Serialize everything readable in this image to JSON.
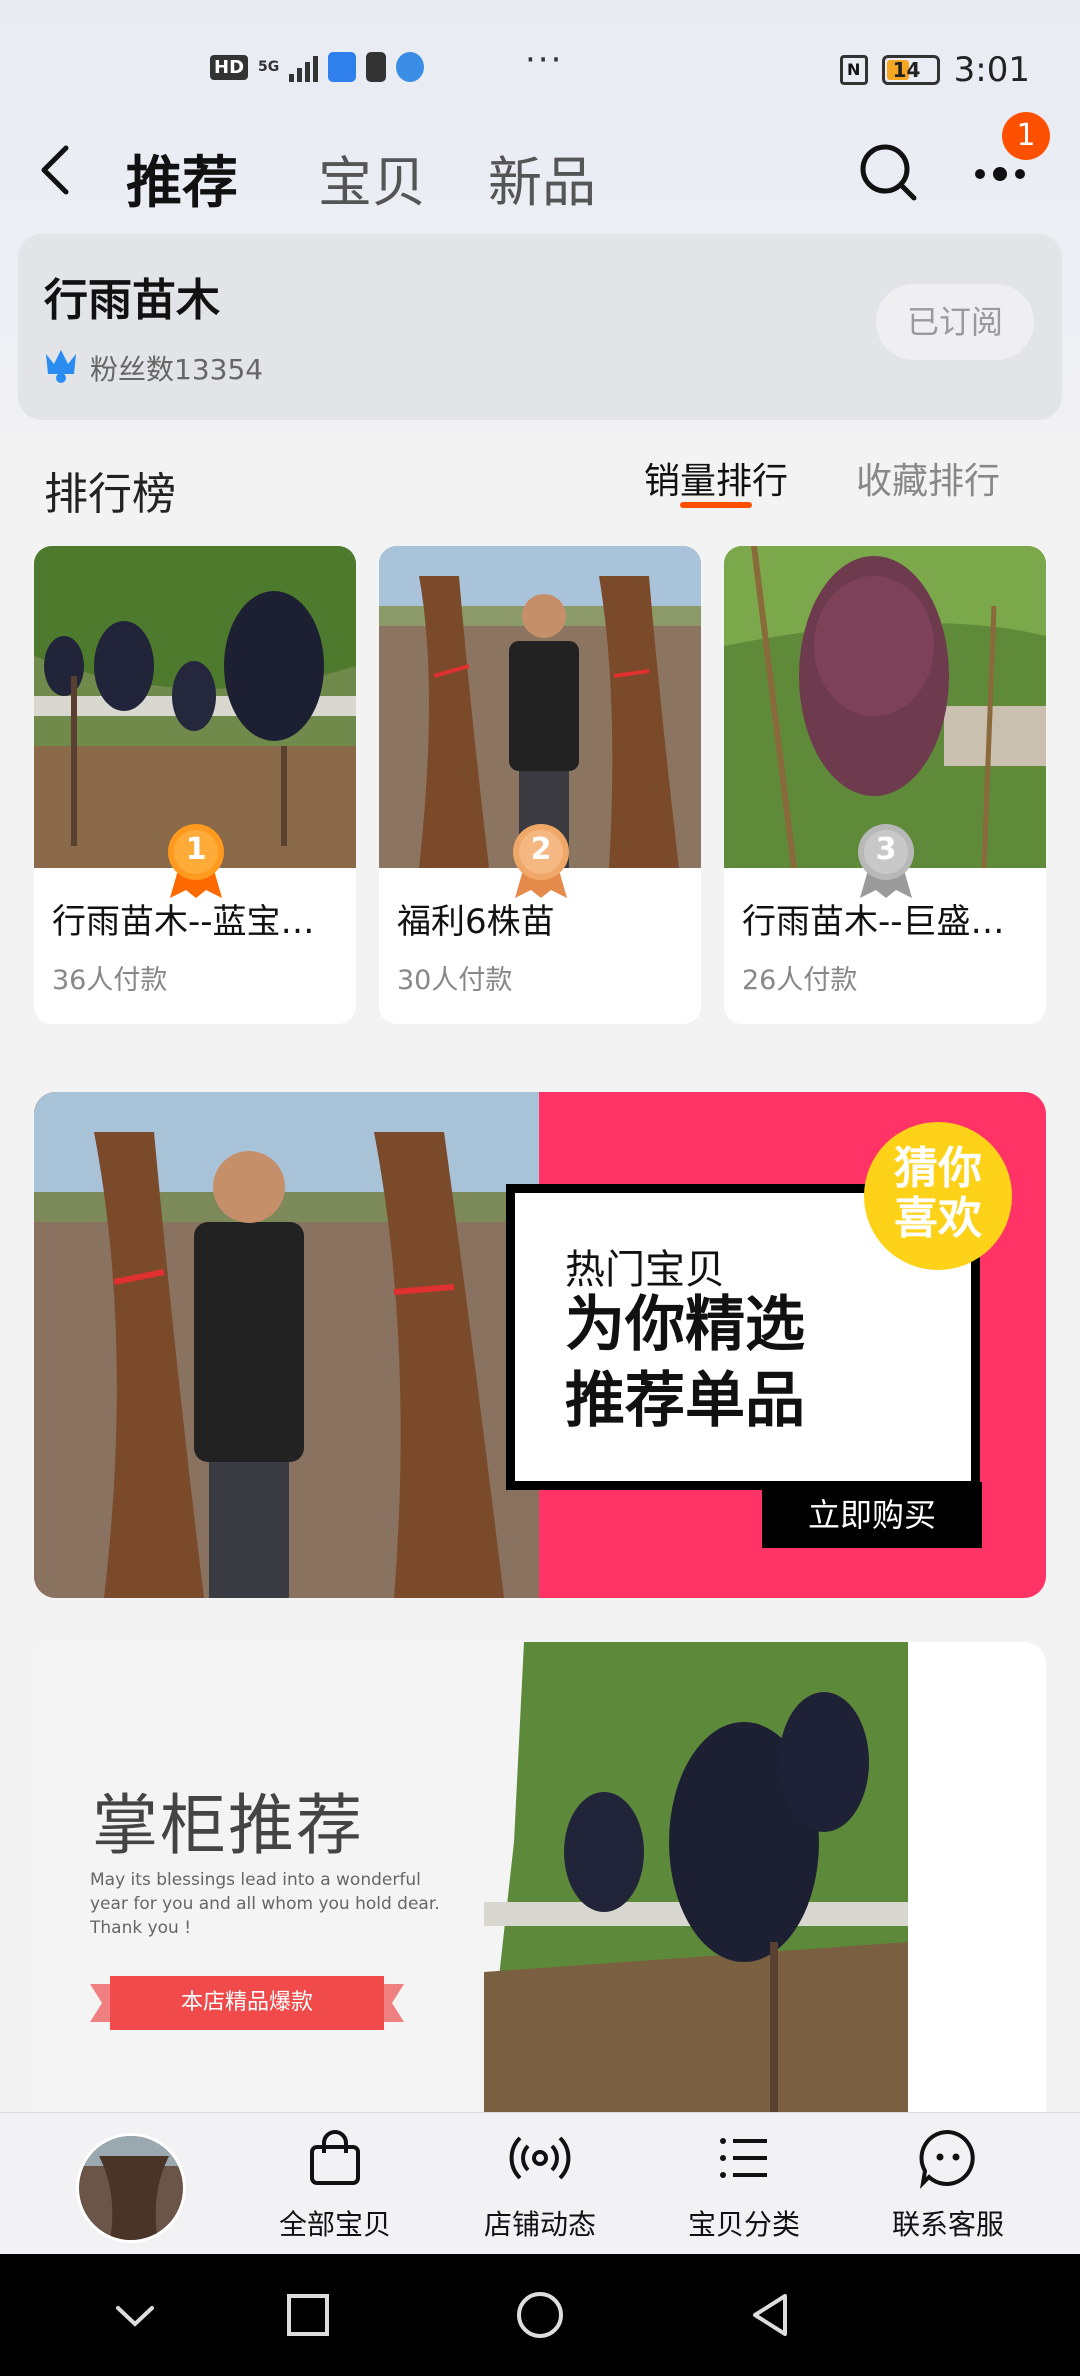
{
  "status_bar": {
    "hd": "HD",
    "network": "5G",
    "dots": "···",
    "nfc": "N",
    "battery": "14",
    "time": "3:01"
  },
  "header": {
    "tabs": [
      {
        "label": "推荐",
        "active": true
      },
      {
        "label": "宝贝",
        "active": false
      },
      {
        "label": "新品",
        "active": false
      }
    ],
    "notification_count": "1"
  },
  "shop": {
    "name": "行雨苗木",
    "fans": "粉丝数13354",
    "subscribe_label": "已订阅"
  },
  "ranking": {
    "title": "排行榜",
    "tabs": [
      {
        "label": "销量排行",
        "active": true
      },
      {
        "label": "收藏排行",
        "active": false
      }
    ],
    "items": [
      {
        "rank": "1",
        "title": "行雨苗木--蓝宝石葡萄苗",
        "sales": "36人付款",
        "medal_color": "#ff9a1f"
      },
      {
        "rank": "2",
        "title": "福利6株苗",
        "sales": "30人付款",
        "medal_color": "#f0a868"
      },
      {
        "rank": "3",
        "title": "行雨苗木--巨盛葡萄苗",
        "sales": "26人付款",
        "medal_color": "#b8b8b8"
      }
    ]
  },
  "banner1": {
    "small_text": "热门宝贝",
    "big_line1": "为你精选",
    "big_line2": "推荐单品",
    "buy_label": "立即购买",
    "guess_line1": "猜你",
    "guess_line2": "喜欢"
  },
  "banner2": {
    "title": "掌柜推荐",
    "english": "May its blessings lead into a wonderful year for you and all whom you hold dear. Thank you !",
    "ribbon": "本店精品爆款"
  },
  "bottom_bar": {
    "items": [
      {
        "label": "全部宝贝",
        "icon": "bag-icon"
      },
      {
        "label": "店铺动态",
        "icon": "broadcast-icon"
      },
      {
        "label": "宝贝分类",
        "icon": "list-icon"
      },
      {
        "label": "联系客服",
        "icon": "chat-face-icon"
      }
    ]
  },
  "colors": {
    "accent": "#ff5000",
    "banner_pink": "#ff3366",
    "banner_yellow": "#ffd21a"
  }
}
